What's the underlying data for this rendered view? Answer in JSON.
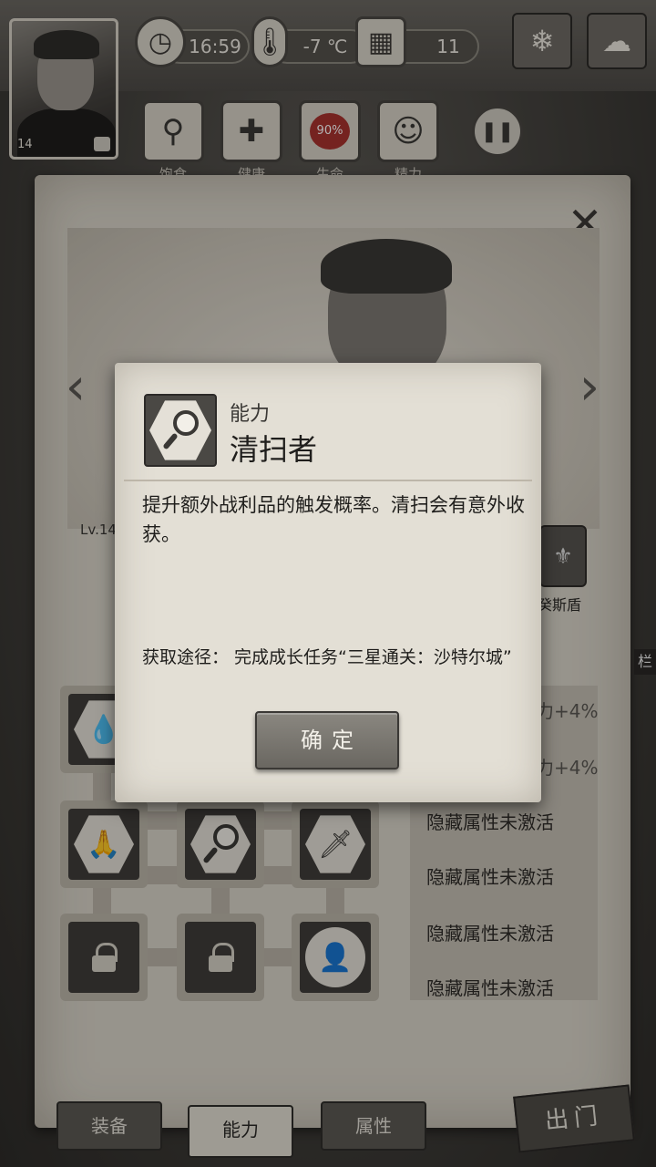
{
  "hud": {
    "time": "16:59",
    "temperature": "-7 ℃",
    "day": "11",
    "avatar_level": "14",
    "weather_icons": [
      "snow-winter-icon",
      "cloud-icon"
    ]
  },
  "status_buttons": [
    {
      "name": "stomach",
      "icon": "stomach-icon",
      "label": "饱食"
    },
    {
      "name": "health",
      "icon": "cross-icon",
      "label": "健康"
    },
    {
      "name": "life",
      "icon": "heart-icon",
      "label": "生命",
      "value": "90%"
    },
    {
      "name": "spirit",
      "icon": "head-icon",
      "label": "精力"
    }
  ],
  "character": {
    "level_label": "Lv.14",
    "equipment_label": "癸斯盾",
    "side_tab": "栏"
  },
  "attributes": [
    {
      "text": "力+4%",
      "partial": true
    },
    {
      "text": "力+4%",
      "partial": true
    },
    {
      "text": "隐藏属性未激活",
      "partial": false
    },
    {
      "text": "隐藏属性未激活",
      "partial": false
    },
    {
      "text": "隐藏属性未激活",
      "partial": false
    },
    {
      "text": "隐藏属性未激活",
      "partial": false
    }
  ],
  "bottom_tabs": {
    "equipment": "装备",
    "ability": "能力",
    "attributes": "属性",
    "exit": "出门"
  },
  "modal": {
    "category": "能力",
    "title": "清扫者",
    "description": "提升额外战利品的触发概率。清扫会有意外收获。",
    "source": "获取途径： 完成成长任务“三星通关：沙特尔城”",
    "confirm_label": "确定"
  }
}
